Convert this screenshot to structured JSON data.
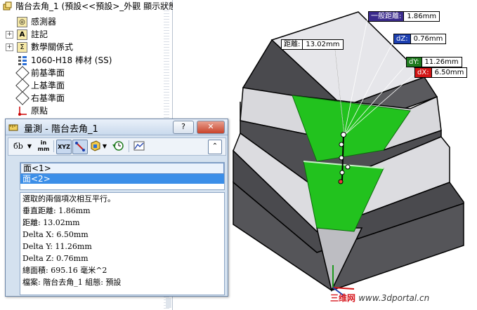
{
  "tree": {
    "items": [
      {
        "label": "階台去角_1 (預設<<預設>_外觀 顯示狀態",
        "icon": "part-icon",
        "expander": ""
      },
      {
        "label": "感測器",
        "icon": "sensor-icon",
        "expander": ""
      },
      {
        "label": "註記",
        "icon": "annotation-icon",
        "expander": "+"
      },
      {
        "label": "數學關係式",
        "icon": "equation-icon",
        "expander": "+"
      },
      {
        "label": "1060-H18 棒材 (SS)",
        "icon": "material-icon",
        "expander": ""
      },
      {
        "label": "前基準面",
        "icon": "plane-icon",
        "expander": ""
      },
      {
        "label": "上基準面",
        "icon": "plane-icon",
        "expander": ""
      },
      {
        "label": "右基準面",
        "icon": "plane-icon",
        "expander": ""
      },
      {
        "label": "原點",
        "icon": "origin-icon",
        "expander": ""
      }
    ],
    "glyphs": {
      "sensor": "◎",
      "annotation": "A",
      "equation": "Σ"
    }
  },
  "callouts": {
    "normal_distance": {
      "tag": "一般距離:",
      "value": "1.86mm",
      "color": "#3a2a8c"
    },
    "distance": {
      "tag": "距離:",
      "value": "13.02mm",
      "color": "#ffffff"
    },
    "dz": {
      "tag": "dZ:",
      "value": "0.76mm",
      "color": "#1c3fb0"
    },
    "dy": {
      "tag": "dY:",
      "value": "11.26mm",
      "color": "#1e7a1e"
    },
    "dx": {
      "tag": "dX:",
      "value": "6.50mm",
      "color": "#d21414"
    }
  },
  "dialog": {
    "title": "量測 - 階台去角_1",
    "help_label": "?",
    "close_label": "✕",
    "toolbar": {
      "arc_options": "бb",
      "units": "in\nmm",
      "xyz": "XYZ",
      "collapse": "⌃"
    },
    "selections": [
      "面<1>",
      "面<2>"
    ],
    "results": [
      "選取的兩個項次相互平行。",
      "垂直距離: 1.86mm",
      "距離: 13.02mm",
      "Delta X: 6.50mm",
      "Delta Y: 11.26mm",
      "Delta Z: 0.76mm",
      "總面積: 695.16 毫米^2",
      "檔案: 階台去角_1 組態: 預設"
    ]
  },
  "watermark": {
    "brand": "三维网",
    "url": "www.3dportal.cn"
  },
  "colors": {
    "face_green": "#22c21e",
    "body_gray": "#4a4a4e",
    "top_light": "#e6e6ea"
  }
}
